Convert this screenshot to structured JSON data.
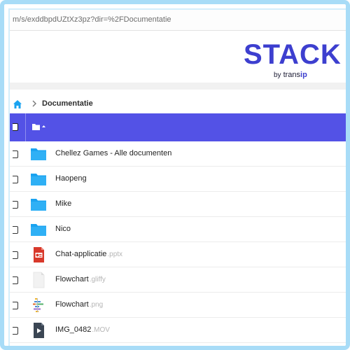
{
  "browser": {
    "url": "m/s/exddbpdUZtXz3pz?dir=%2FDocumentatie"
  },
  "brand": {
    "title": "STACK",
    "sub_by": "by",
    "sub_trans": "trans",
    "sub_ip": "ip"
  },
  "breadcrumb": {
    "home_icon": "home-icon",
    "current": "Documentatie"
  },
  "colors": {
    "header": "#5352e6",
    "accent": "#3d3fcf",
    "folder": "#1aa3f0"
  },
  "files": [
    {
      "name": "Chellez Games - Alle documenten",
      "ext": "",
      "icon": "folder-icon"
    },
    {
      "name": "Haopeng",
      "ext": "",
      "icon": "folder-icon"
    },
    {
      "name": "Mike",
      "ext": "",
      "icon": "folder-icon"
    },
    {
      "name": "Nico",
      "ext": "",
      "icon": "folder-icon"
    },
    {
      "name": "Chat-applicatie",
      "ext": ".pptx",
      "icon": "presentation-file-icon"
    },
    {
      "name": "Flowchart",
      "ext": ".gliffy",
      "icon": "blank-file-icon"
    },
    {
      "name": "Flowchart",
      "ext": ".png",
      "icon": "image-file-icon"
    },
    {
      "name": "IMG_0482",
      "ext": ".MOV",
      "icon": "video-file-icon"
    }
  ]
}
